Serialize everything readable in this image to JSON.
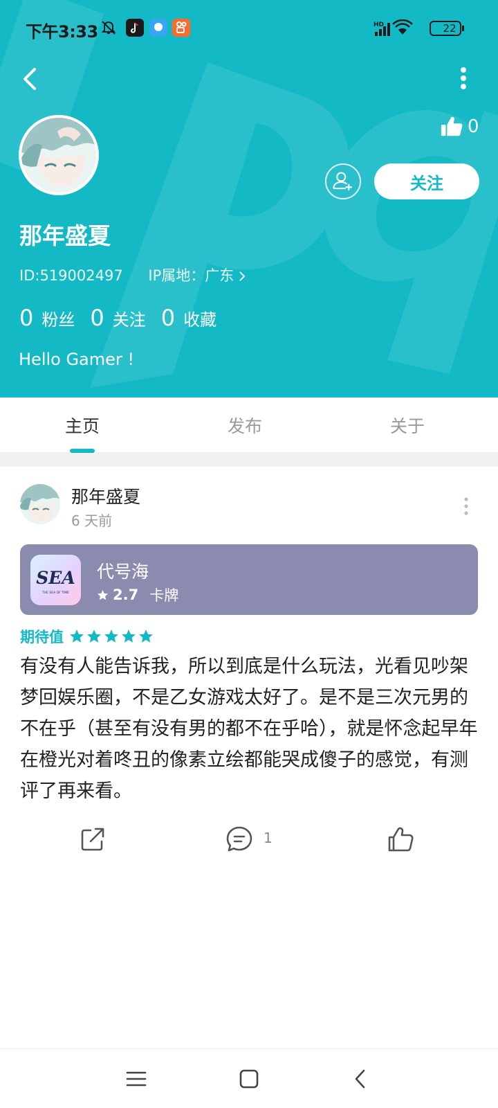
{
  "status_bar": {
    "time": "下午3:33",
    "battery": "22",
    "network": "HD",
    "app_icons": [
      "mute-icon",
      "douyin-icon",
      "message-icon",
      "kuaishou-icon"
    ]
  },
  "profile": {
    "name": "那年盛夏",
    "id_text": "ID:519002497",
    "ip_text": "IP属地：广东",
    "bio": "Hello Gamer !",
    "like_count": "0",
    "follow_label": "关注",
    "stats": [
      {
        "num": "0",
        "label": "粉丝"
      },
      {
        "num": "0",
        "label": "关注"
      },
      {
        "num": "0",
        "label": "收藏"
      }
    ]
  },
  "tabs": [
    "主页",
    "发布",
    "关于"
  ],
  "active_tab": "主页",
  "post": {
    "author": "那年盛夏",
    "time": "6 天前",
    "game": {
      "name": "代号海",
      "score": "2.7",
      "genre": "卡牌",
      "icon_text": "SEA",
      "icon_subtext": "THE SEA OF TIME"
    },
    "expect_label": "期待值",
    "expect_stars": 5,
    "body": "有没有人能告诉我，所以到底是什么玩法，光看见吵架梦回娱乐圈，不是乙女游戏太好了。是不是三次元男的不在乎（甚至有没有男的都不在乎哈），就是怀念起早年在橙光对着咚丑的像素立绘都能哭成傻子的感觉，有测评了再来看。",
    "comment_count": "1"
  },
  "colors": {
    "accent": "#14b9c6",
    "card": "#8b8bb0"
  }
}
